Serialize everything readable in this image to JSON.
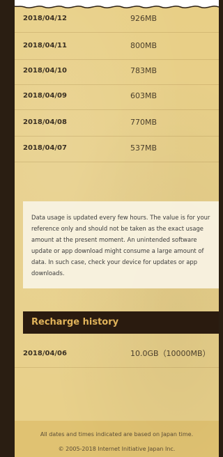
{
  "usage_rows": [
    {
      "date": "2018/04/12",
      "amount": "926MB"
    },
    {
      "date": "2018/04/11",
      "amount": "800MB"
    },
    {
      "date": "2018/04/10",
      "amount": "783MB"
    },
    {
      "date": "2018/04/09",
      "amount": "603MB"
    },
    {
      "date": "2018/04/08",
      "amount": "770MB"
    },
    {
      "date": "2018/04/07",
      "amount": "537MB"
    }
  ],
  "note": {
    "lines": [
      "Data usage is updated every few hours. The value is for your",
      "reference only and should not be taken as the exact usage",
      "amount at the present moment. An unintended software",
      "update or app download might consume a large amount of",
      "data. In such case, check your device for updates or app",
      "downloads."
    ]
  },
  "recharge": {
    "title": "Recharge history",
    "rows": [
      {
        "date": "2018/04/06",
        "amount": "10.0GB（10000MB）"
      }
    ]
  },
  "footer": {
    "line1": "All dates and times indicated are based on Japan time.",
    "line2": "© 2005-2018 Internet Initiative Japan Inc."
  }
}
